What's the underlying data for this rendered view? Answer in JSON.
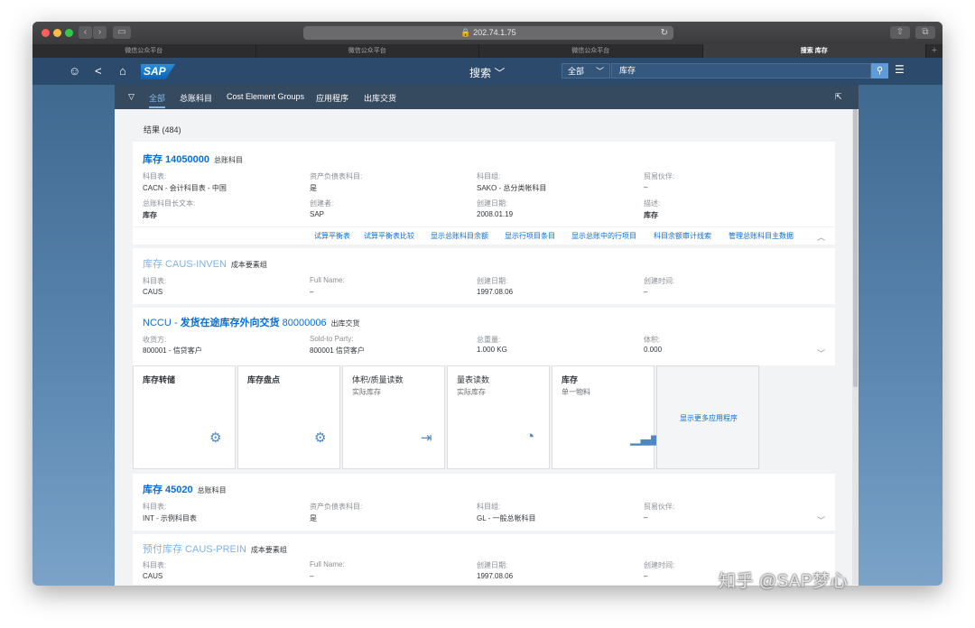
{
  "browser": {
    "url": "🔒 202.74.1.75",
    "tabs": [
      "微信公众平台",
      "微信公众平台",
      "微信公众平台",
      "搜索 库存"
    ],
    "new_tab": "+"
  },
  "shell": {
    "logo": "SAP",
    "title": "搜索 ﹀",
    "scope": "全部",
    "query": "库存"
  },
  "filter_tabs": [
    "全部",
    "总账科目",
    "Cost Element Groups",
    "应用程序",
    "出库交货"
  ],
  "results_label": "结果 (484)",
  "card1": {
    "title": "库存 14050000",
    "type": "总账科目",
    "fields": [
      {
        "label": "科目表:",
        "value": "CACN - 会计科目表 - 中国"
      },
      {
        "label": "资产负债表科目:",
        "value": "是"
      },
      {
        "label": "科目组:",
        "value": "SAKO - 总分类帐科目"
      },
      {
        "label": "贸易伙伴:",
        "value": "–"
      },
      {
        "label": "总账科目长文本:",
        "value": "库存"
      },
      {
        "label": "创建者:",
        "value": "SAP"
      },
      {
        "label": "创建日期:",
        "value": "2008.01.19"
      },
      {
        "label": "描述:",
        "value": "库存"
      }
    ],
    "actions": [
      "试算平衡表",
      "试算平衡表比较",
      "显示总账科目余额",
      "显示行项目条目",
      "显示总账中的行项目",
      "科目余额审计线索",
      "管理总账科目主数据"
    ]
  },
  "card2": {
    "title": "库存 CAUS-INVEN",
    "type": "成本要素组",
    "fields": [
      {
        "label": "科目表:",
        "value": "CAUS"
      },
      {
        "label": "Full Name:",
        "value": "–"
      },
      {
        "label": "创建日期:",
        "value": "1997.08.06"
      },
      {
        "label": "创建时间:",
        "value": "–"
      }
    ]
  },
  "card3": {
    "title_a": "NCCU - ",
    "title_b": "发货在途库存外向交货",
    "title_c": " 80000006",
    "type": "出库交货",
    "fields": [
      {
        "label": "收货方:",
        "value": "800001 - 信贷客户"
      },
      {
        "label": "Sold-to Party:",
        "value": "800001 信贷客户"
      },
      {
        "label": "总重量:",
        "value": "1.000 KG"
      },
      {
        "label": "体积:",
        "value": "0.000"
      }
    ]
  },
  "tiles": [
    {
      "title": "库存转储",
      "sub": ""
    },
    {
      "title": "库存盘点",
      "sub": ""
    },
    {
      "title": "体积/质量读数",
      "sub": "实际库存"
    },
    {
      "title": "量表读数",
      "sub": "实际库存"
    },
    {
      "title": "库存",
      "sub": "单一物料"
    }
  ],
  "tiles_more": "显示更多应用程序",
  "card4": {
    "title": "库存 45020",
    "type": "总账科目",
    "fields": [
      {
        "label": "科目表:",
        "value": "INT - 示例科目表"
      },
      {
        "label": "资产负债表科目:",
        "value": "是"
      },
      {
        "label": "科目组:",
        "value": "GL - 一般总帐科目"
      },
      {
        "label": "贸易伙伴:",
        "value": "–"
      }
    ]
  },
  "card5": {
    "title": "预付库存 CAUS-PREIN",
    "type": "成本要素组",
    "fields": [
      {
        "label": "科目表:",
        "value": "CAUS"
      },
      {
        "label": "Full Name:",
        "value": "–"
      },
      {
        "label": "创建日期:",
        "value": "1997.08.06"
      },
      {
        "label": "创建时间:",
        "value": "–"
      }
    ]
  },
  "watermark": "知乎 @SAP梦心"
}
